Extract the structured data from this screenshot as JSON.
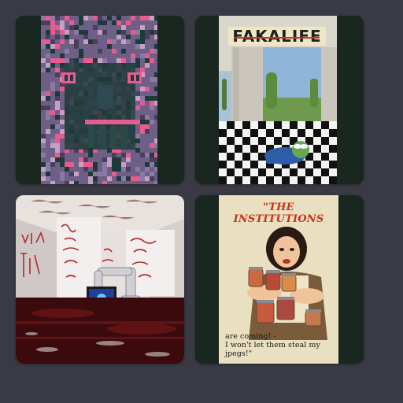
{
  "cards": [
    {
      "id": "nft-pixel-glitch",
      "alt": "pixel glitch artwork"
    },
    {
      "id": "nft-fakalife",
      "title": "FAKALIFE"
    },
    {
      "id": "nft-red-room",
      "alt": "gallery room with red graffiti and robot arm"
    },
    {
      "id": "nft-institutions",
      "headline": "\"THE INSTITUTIONS",
      "caption_line1": "are coming! -",
      "caption_line2": "I won't let them steal my jpegs!\""
    }
  ],
  "colors": {
    "background": "#3a3a44",
    "card_bg": "#1a2620",
    "glitch_purple": "#6e5f86",
    "glitch_pink": "#e75b8e",
    "glitch_teal": "#1d3b3a",
    "poster_red": "#c8321f",
    "poster_bg": "#e9dfc1"
  }
}
